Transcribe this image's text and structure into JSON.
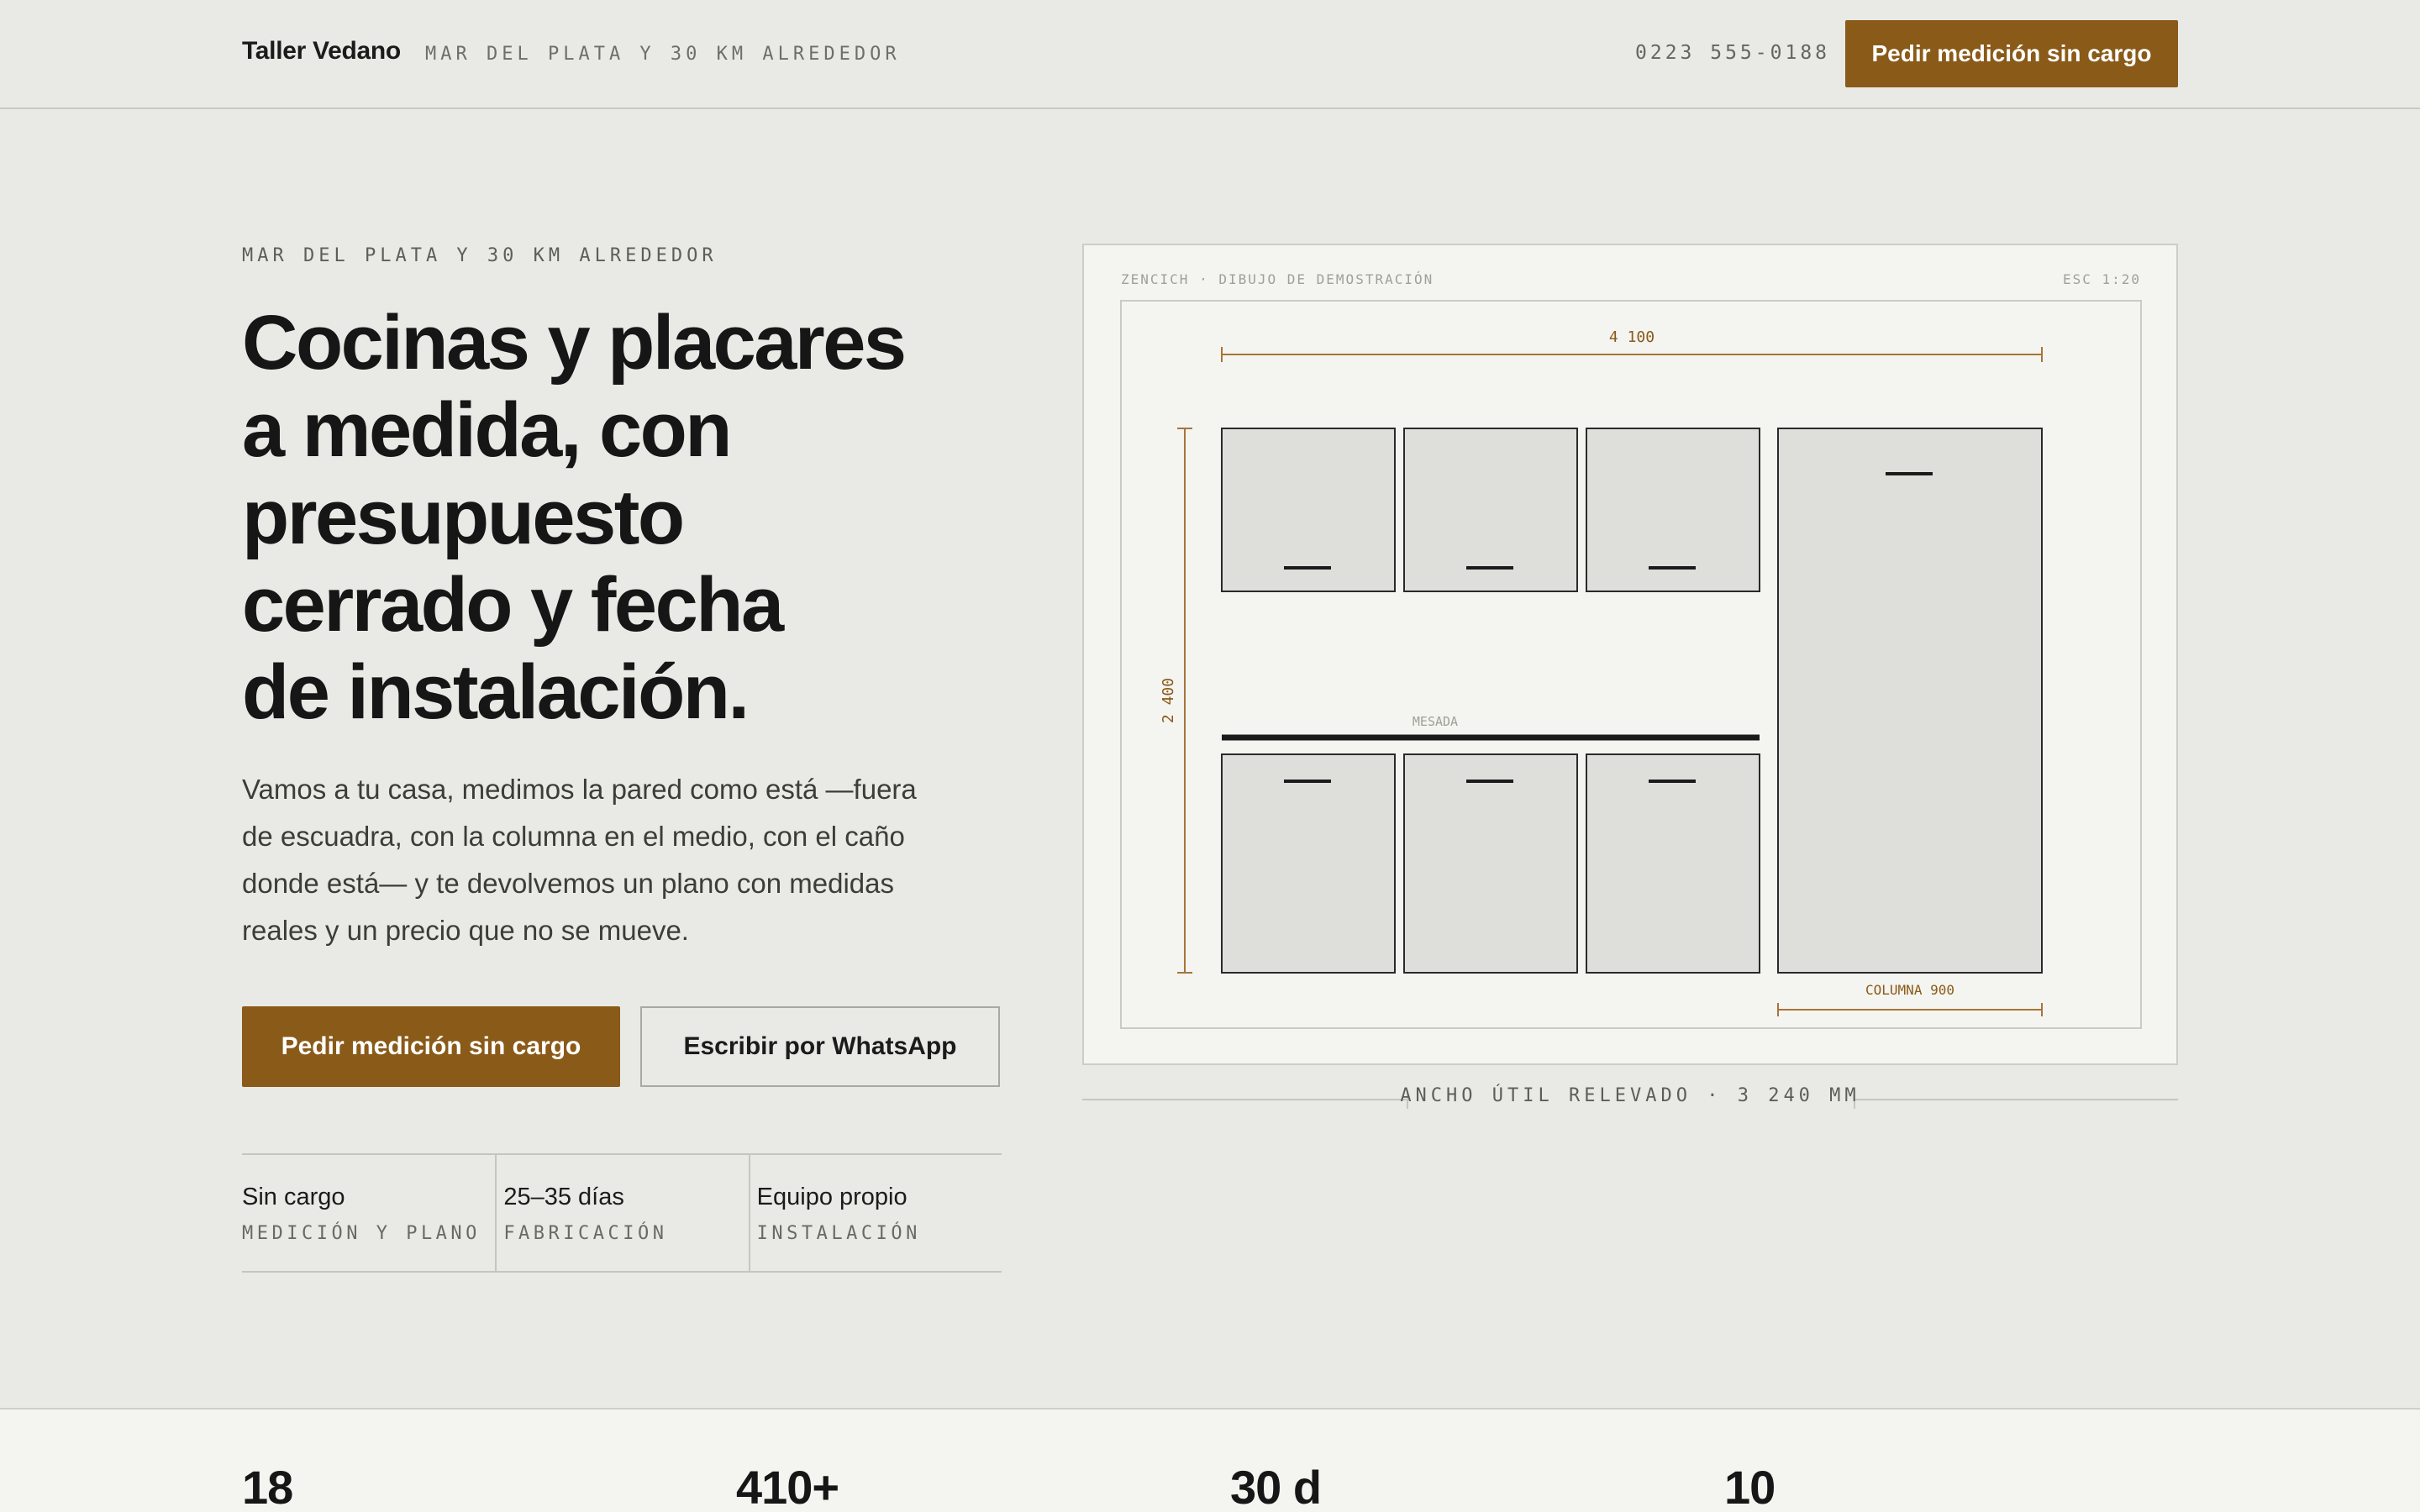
{
  "header": {
    "brand": "Taller Vedano",
    "location": "MAR DEL PLATA Y 30 KM ALREDEDOR",
    "phone": "0223 555-0188",
    "cta": "Pedir medición sin cargo"
  },
  "hero": {
    "eyebrow": "MAR DEL PLATA Y 30 KM ALREDEDOR",
    "title_lines": [
      "Cocinas y placares",
      "a medida, con",
      "presupuesto",
      "cerrado y fecha",
      "de instalación."
    ],
    "description_lines": [
      "Vamos a tu casa, medimos la pared como está —fuera",
      "de escuadra, con la columna en el medio, con el caño",
      "donde está— y te devolvemos un plano con medidas",
      "reales y un precio que no se mueve."
    ],
    "cta_primary": "Pedir medición sin cargo",
    "cta_secondary": "Escribir por WhatsApp",
    "features": [
      {
        "value": "Sin cargo",
        "label": "MEDICIÓN Y PLANO"
      },
      {
        "value": "25–35 días",
        "label": "FABRICACIÓN"
      },
      {
        "value": "Equipo propio",
        "label": "INSTALACIÓN"
      }
    ]
  },
  "drawing": {
    "header_left": "ZENCICH · DIBUJO DE DEMOSTRACIÓN",
    "header_right": "ESC 1:20",
    "width_dim": "4 100",
    "height_dim": "2 400",
    "counter_label": "MESADA",
    "column_label": "COLUMNA 900",
    "caption": "ANCHO ÚTIL RELEVADO · 3 240 MM",
    "colors": {
      "accent": "#8a5a18",
      "cabinet_fill": "#dededb",
      "line": "#1b1b1b"
    }
  },
  "stats": [
    "18",
    "410+",
    "30 d",
    "10"
  ]
}
